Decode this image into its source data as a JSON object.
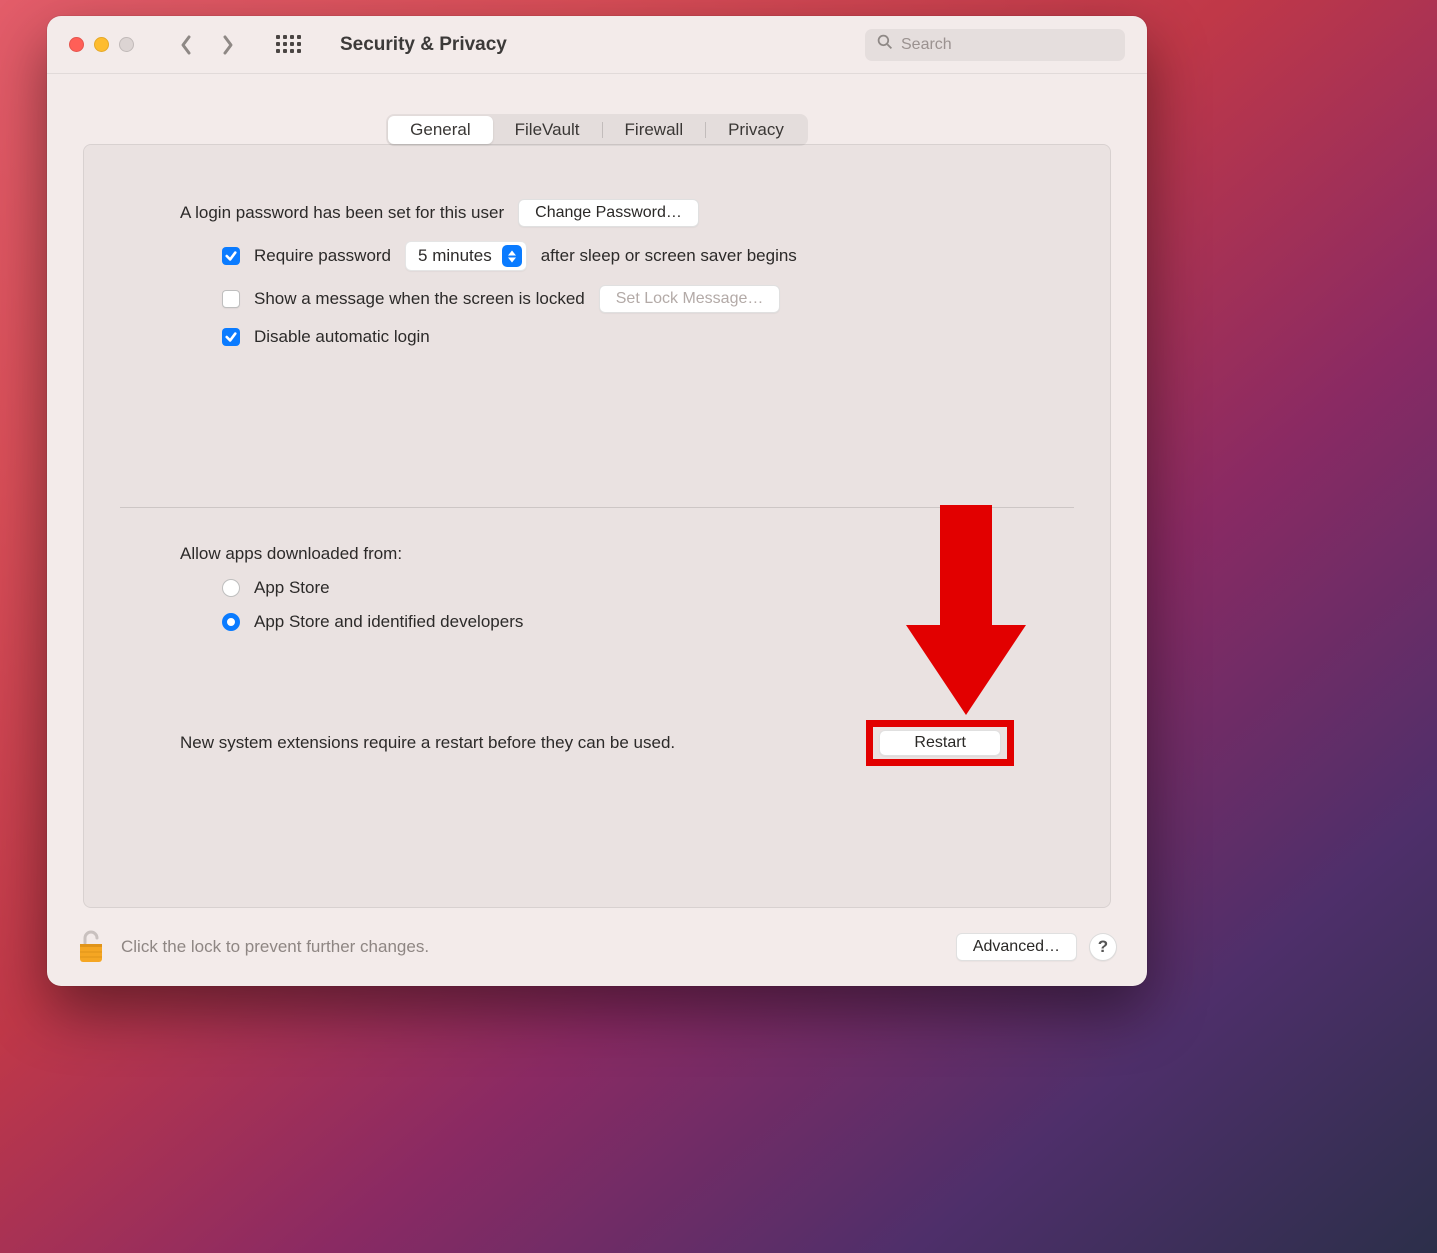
{
  "window": {
    "title": "Security & Privacy"
  },
  "search": {
    "placeholder": "Search"
  },
  "tabs": [
    "General",
    "FileVault",
    "Firewall",
    "Privacy"
  ],
  "activeTab": 0,
  "general": {
    "loginPasswordText": "A login password has been set for this user",
    "changePasswordLabel": "Change Password…",
    "requirePasswordLabel": "Require password",
    "requirePasswordChecked": true,
    "requireDelay": "5 minutes",
    "requirePasswordAfter": "after sleep or screen saver begins",
    "showMessageLabel": "Show a message when the screen is locked",
    "showMessageChecked": false,
    "setLockMessageLabel": "Set Lock Message…",
    "disableAutoLoginLabel": "Disable automatic login",
    "disableAutoLoginChecked": true,
    "allowAppsLabel": "Allow apps downloaded from:",
    "allowOptions": [
      "App Store",
      "App Store and identified developers"
    ],
    "allowSelected": 1,
    "restartText": "New system extensions require a restart before they can be used.",
    "restartLabel": "Restart"
  },
  "footer": {
    "lockText": "Click the lock to prevent further changes.",
    "advancedLabel": "Advanced…",
    "helpLabel": "?"
  },
  "annotation": {
    "color": "#e20000"
  }
}
